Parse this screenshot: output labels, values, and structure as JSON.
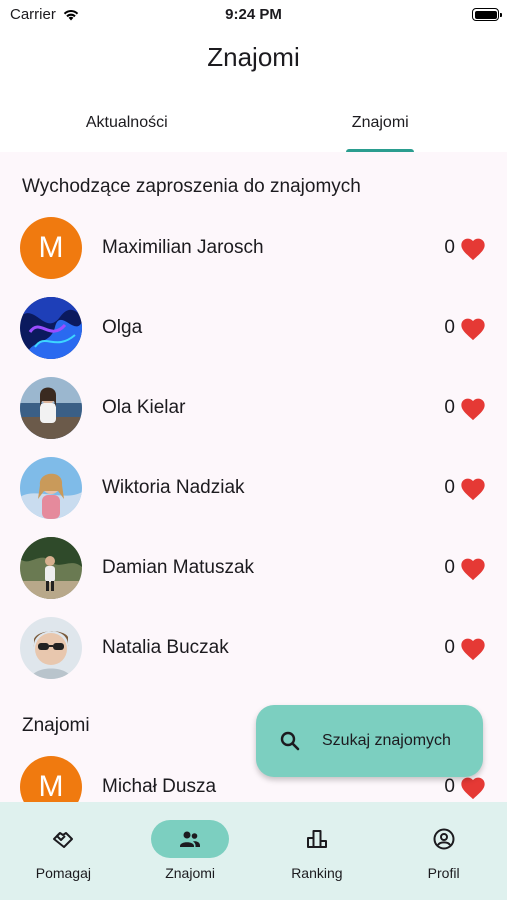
{
  "status_bar": {
    "carrier": "Carrier",
    "time": "9:24 PM"
  },
  "header": {
    "title": "Znajomi"
  },
  "tabs": [
    {
      "label": "Aktualności",
      "active": false
    },
    {
      "label": "Znajomi",
      "active": true
    }
  ],
  "outgoing": {
    "title": "Wychodzące zaproszenia do znajomych",
    "items": [
      {
        "name": "Maximilian Jarosch",
        "count": "0",
        "initial": "M"
      },
      {
        "name": "Olga",
        "count": "0"
      },
      {
        "name": "Ola Kielar",
        "count": "0"
      },
      {
        "name": "Wiktoria Nadziak",
        "count": "0"
      },
      {
        "name": "Damian Matuszak",
        "count": "0"
      },
      {
        "name": "Natalia Buczak",
        "count": "0"
      }
    ]
  },
  "friends": {
    "title": "Znajomi",
    "items": [
      {
        "name": "Michał Dusza",
        "count": "0",
        "initial": "M"
      }
    ]
  },
  "fab": {
    "label": "Szukaj znajomych",
    "icon": "search-icon"
  },
  "bottom_nav": [
    {
      "label": "Pomagaj",
      "icon": "handshake-icon",
      "active": false
    },
    {
      "label": "Znajomi",
      "icon": "people-icon",
      "active": true
    },
    {
      "label": "Ranking",
      "icon": "leaderboard-icon",
      "active": false
    },
    {
      "label": "Profil",
      "icon": "account-circle-icon",
      "active": false
    }
  ],
  "colors": {
    "accent": "#2a9d8f",
    "fab": "#7ccfc0",
    "nav_bg": "#dff1ee",
    "heart": "#e53935",
    "avatar_letter_bg": "#f07a0f"
  }
}
